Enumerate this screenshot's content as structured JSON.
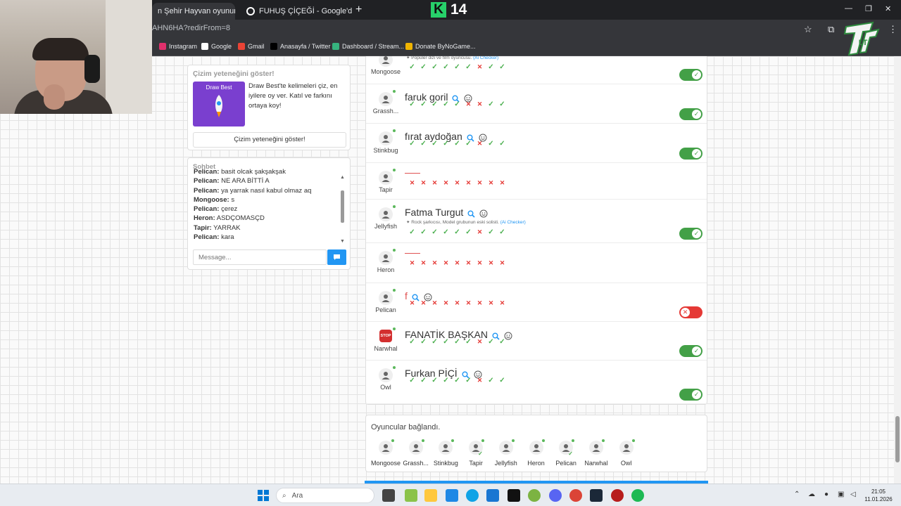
{
  "browser": {
    "tabs": [
      {
        "label": "n Şehir Hayvan oyununa katıl"
      },
      {
        "label": "FUHUŞ ÇİÇEĞİ - Google'da Ara"
      }
    ],
    "url": "AHN6HA?redirFrom=8",
    "bookmarks": [
      {
        "label": "Instagram",
        "color": "#e1306c"
      },
      {
        "label": "Google",
        "color": "#ffffff"
      },
      {
        "label": "Gmail",
        "color": "#ea4335"
      },
      {
        "label": "Anasayfa / Twitter",
        "color": "#000000"
      },
      {
        "label": "Dashboard / Stream...",
        "color": "#36b37e"
      },
      {
        "label": "Donate ByNoGame...",
        "color": "#f0b400"
      }
    ],
    "k14_logo": {
      "letter": "K",
      "number": "14",
      "color": "#27d16a"
    },
    "overlay_logo": "LT"
  },
  "promo": {
    "title": "Çizim yeteneğini göster!",
    "thumb_title": "Draw Best",
    "text": "Draw Best'te kelimeleri çiz, en iyilere oy ver. Katıl ve farkını ortaya koy!",
    "button": "Çizim yeteneğini göster!"
  },
  "chat": {
    "title": "Sohbet",
    "messages": [
      {
        "user": "Pelican:",
        "text": "basit olcak şakşakşak"
      },
      {
        "user": "Pelican:",
        "text": "NE ARA BİTTİ A"
      },
      {
        "user": "Pelican:",
        "text": "ya yarrak nasıl kabul olmaz aq"
      },
      {
        "user": "Mongoose:",
        "text": "s"
      },
      {
        "user": "Pelican:",
        "text": "çerez"
      },
      {
        "user": "Heron:",
        "text": "ASDÇOMASÇD"
      },
      {
        "user": "Tapir:",
        "text": "YARRAK"
      },
      {
        "user": "Pelican:",
        "text": "kara"
      }
    ],
    "placeholder": "Message..."
  },
  "answers": [
    {
      "player": "Mongoose",
      "word": "",
      "hint": "Popüler dizi ve film oyuncusu.",
      "hint_source": "(Ai Checker)",
      "marks": [
        1,
        1,
        1,
        1,
        1,
        1,
        0,
        1,
        1
      ],
      "approved": true
    },
    {
      "player": "Grassh...",
      "word": "faruk goril",
      "hint": "",
      "hint_source": "",
      "marks": [
        1,
        1,
        1,
        1,
        1,
        0,
        0,
        1,
        1
      ],
      "approved": true
    },
    {
      "player": "Stinkbug",
      "word": "fırat aydoğan",
      "hint": "",
      "hint_source": "",
      "marks": [
        1,
        1,
        1,
        1,
        1,
        1,
        0,
        1,
        1
      ],
      "approved": true
    },
    {
      "player": "Tapir",
      "word": "",
      "hint": "",
      "hint_source": "",
      "marks": [
        0,
        0,
        0,
        0,
        0,
        0,
        0,
        0,
        0
      ],
      "approved": null
    },
    {
      "player": "Jellyfish",
      "word": "Fatma Turgut",
      "hint": "Rock şarkıcısı, Model grubunun eski solisti.",
      "hint_source": "(Ai Checker)",
      "marks": [
        1,
        1,
        1,
        1,
        1,
        1,
        0,
        1,
        1
      ],
      "approved": true
    },
    {
      "player": "Heron",
      "word": "",
      "hint": "",
      "hint_source": "",
      "marks": [
        0,
        0,
        0,
        0,
        0,
        0,
        0,
        0,
        0
      ],
      "approved": null
    },
    {
      "player": "Pelican",
      "word": "f",
      "hint": "",
      "hint_source": "",
      "marks": [
        0,
        0,
        0,
        0,
        0,
        0,
        0,
        0,
        0
      ],
      "approved": false
    },
    {
      "player": "Narwhal",
      "word": "FANATİK BAŞKAN",
      "hint": "",
      "hint_source": "",
      "marks": [
        1,
        1,
        1,
        1,
        1,
        1,
        0,
        1,
        1
      ],
      "approved": true
    },
    {
      "player": "Owl",
      "word": "Furkan PİÇİ",
      "hint": "",
      "hint_source": "",
      "marks": [
        1,
        1,
        1,
        1,
        1,
        1,
        0,
        1,
        1
      ],
      "approved": true
    }
  ],
  "connected": {
    "title": "Oyuncular bağlandı.",
    "players": [
      "Mongoose",
      "Grassh...",
      "Stinkbug",
      "Tapir",
      "Jellyfish",
      "Heron",
      "Pelican",
      "Narwhal",
      "Owl"
    ]
  },
  "taskbar": {
    "search": "Ara",
    "time": "21:05",
    "date": "11.01.2026"
  },
  "colors": {
    "accent": "#2196f3",
    "ok": "#4cb050",
    "bad": "#e53935"
  }
}
